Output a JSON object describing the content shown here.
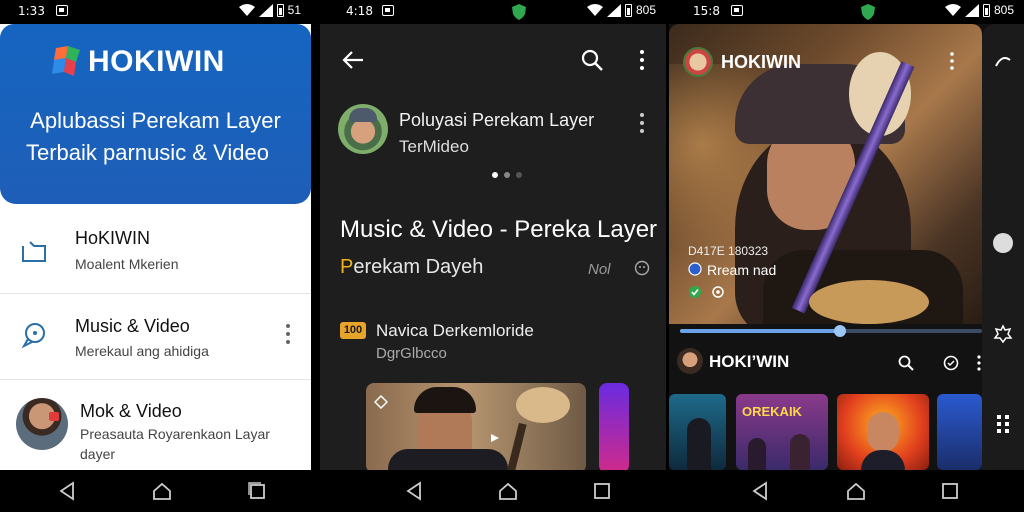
{
  "status_bars": [
    {
      "time": "1:33",
      "right_text": "51"
    },
    {
      "time": "4:18",
      "right_text": "805"
    },
    {
      "time": "15:8",
      "right_text": "805"
    }
  ],
  "screen1": {
    "brand": "HOKIWIN",
    "hero_line1": "Aplubassi Perekam Layer",
    "hero_line2": "Terbaik parnusic & Video",
    "items": [
      {
        "title": "HoKIWIN",
        "subtitle": "Moalent Mkerien",
        "icon": "folder-icon"
      },
      {
        "title": "Music & Video",
        "subtitle": "Merekaul ang ahidiga",
        "icon": "chat-icon"
      },
      {
        "title": "Mok & Video",
        "subtitle": "Preasauta Royarenkaon Layar",
        "subtitle2": "dayer",
        "icon": "avatar"
      }
    ]
  },
  "screen2": {
    "profile_title": "Poluyasi Perekam Layer",
    "profile_subtitle": "TerMideo",
    "heading": "Music & Video - Pereka Layer",
    "sub_accent": "P",
    "sub_rest": "erekam Dayeh",
    "note": "Nol",
    "badge": "100",
    "row_title": "Navica Derkemloride",
    "row_subtitle": "DgrGlbcco"
  },
  "screen3": {
    "brand": "HOKIWIN",
    "date": "D417E 180323",
    "stream_label": "Rream nad",
    "progress": 0.53,
    "bar_title": "HOKI’WIN",
    "tile_text": "OREKAIK"
  },
  "colors": {
    "hero_blue": "#1565c0",
    "accent_orange": "#e8a42a",
    "progress_blue": "#6aa3e8"
  }
}
